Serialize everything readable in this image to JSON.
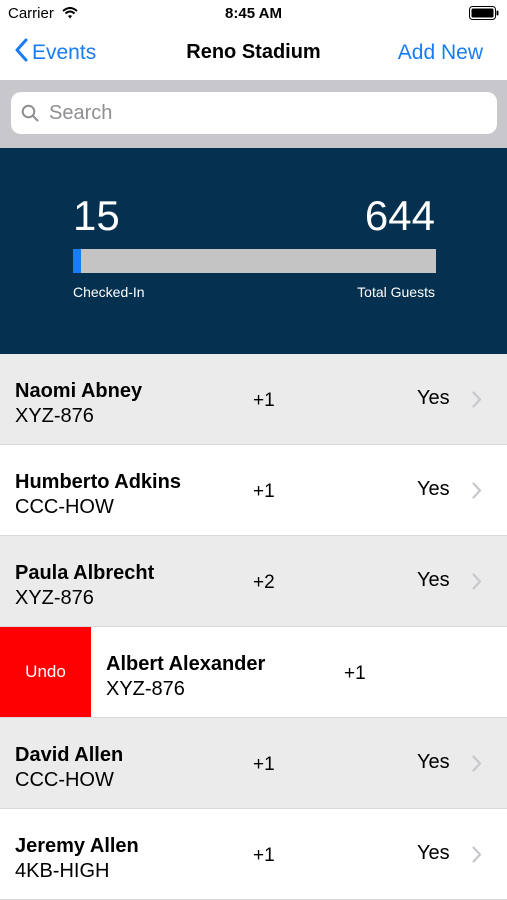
{
  "status_bar": {
    "carrier": "Carrier",
    "time": "8:45 AM"
  },
  "nav": {
    "back_label": "Events",
    "title": "Reno Stadium",
    "add_label": "Add New"
  },
  "search": {
    "placeholder": "Search",
    "value": ""
  },
  "stats": {
    "checked_in": "15",
    "total": "644",
    "checked_label": "Checked-In",
    "total_label": "Total Guests",
    "progress_fraction": 0.023
  },
  "colors": {
    "accent": "#1a7cf5",
    "panel": "#05304f",
    "undo": "#ff0000",
    "row_shade": "#ebebeb"
  },
  "guests": [
    {
      "name": "Naomi Abney",
      "code": "XYZ-876",
      "plus": "+1",
      "status": "Yes"
    },
    {
      "name": "Humberto Adkins",
      "code": "CCC-HOW",
      "plus": "+1",
      "status": "Yes"
    },
    {
      "name": "Paula Albrecht",
      "code": "XYZ-876",
      "plus": "+2",
      "status": "Yes"
    },
    {
      "name": "Albert Alexander",
      "code": "XYZ-876",
      "plus": "+1",
      "status": "",
      "action_label": "Undo"
    },
    {
      "name": "David Allen",
      "code": "CCC-HOW",
      "plus": "+1",
      "status": "Yes"
    },
    {
      "name": "Jeremy Allen",
      "code": "4KB-HIGH",
      "plus": "+1",
      "status": "Yes"
    }
  ]
}
